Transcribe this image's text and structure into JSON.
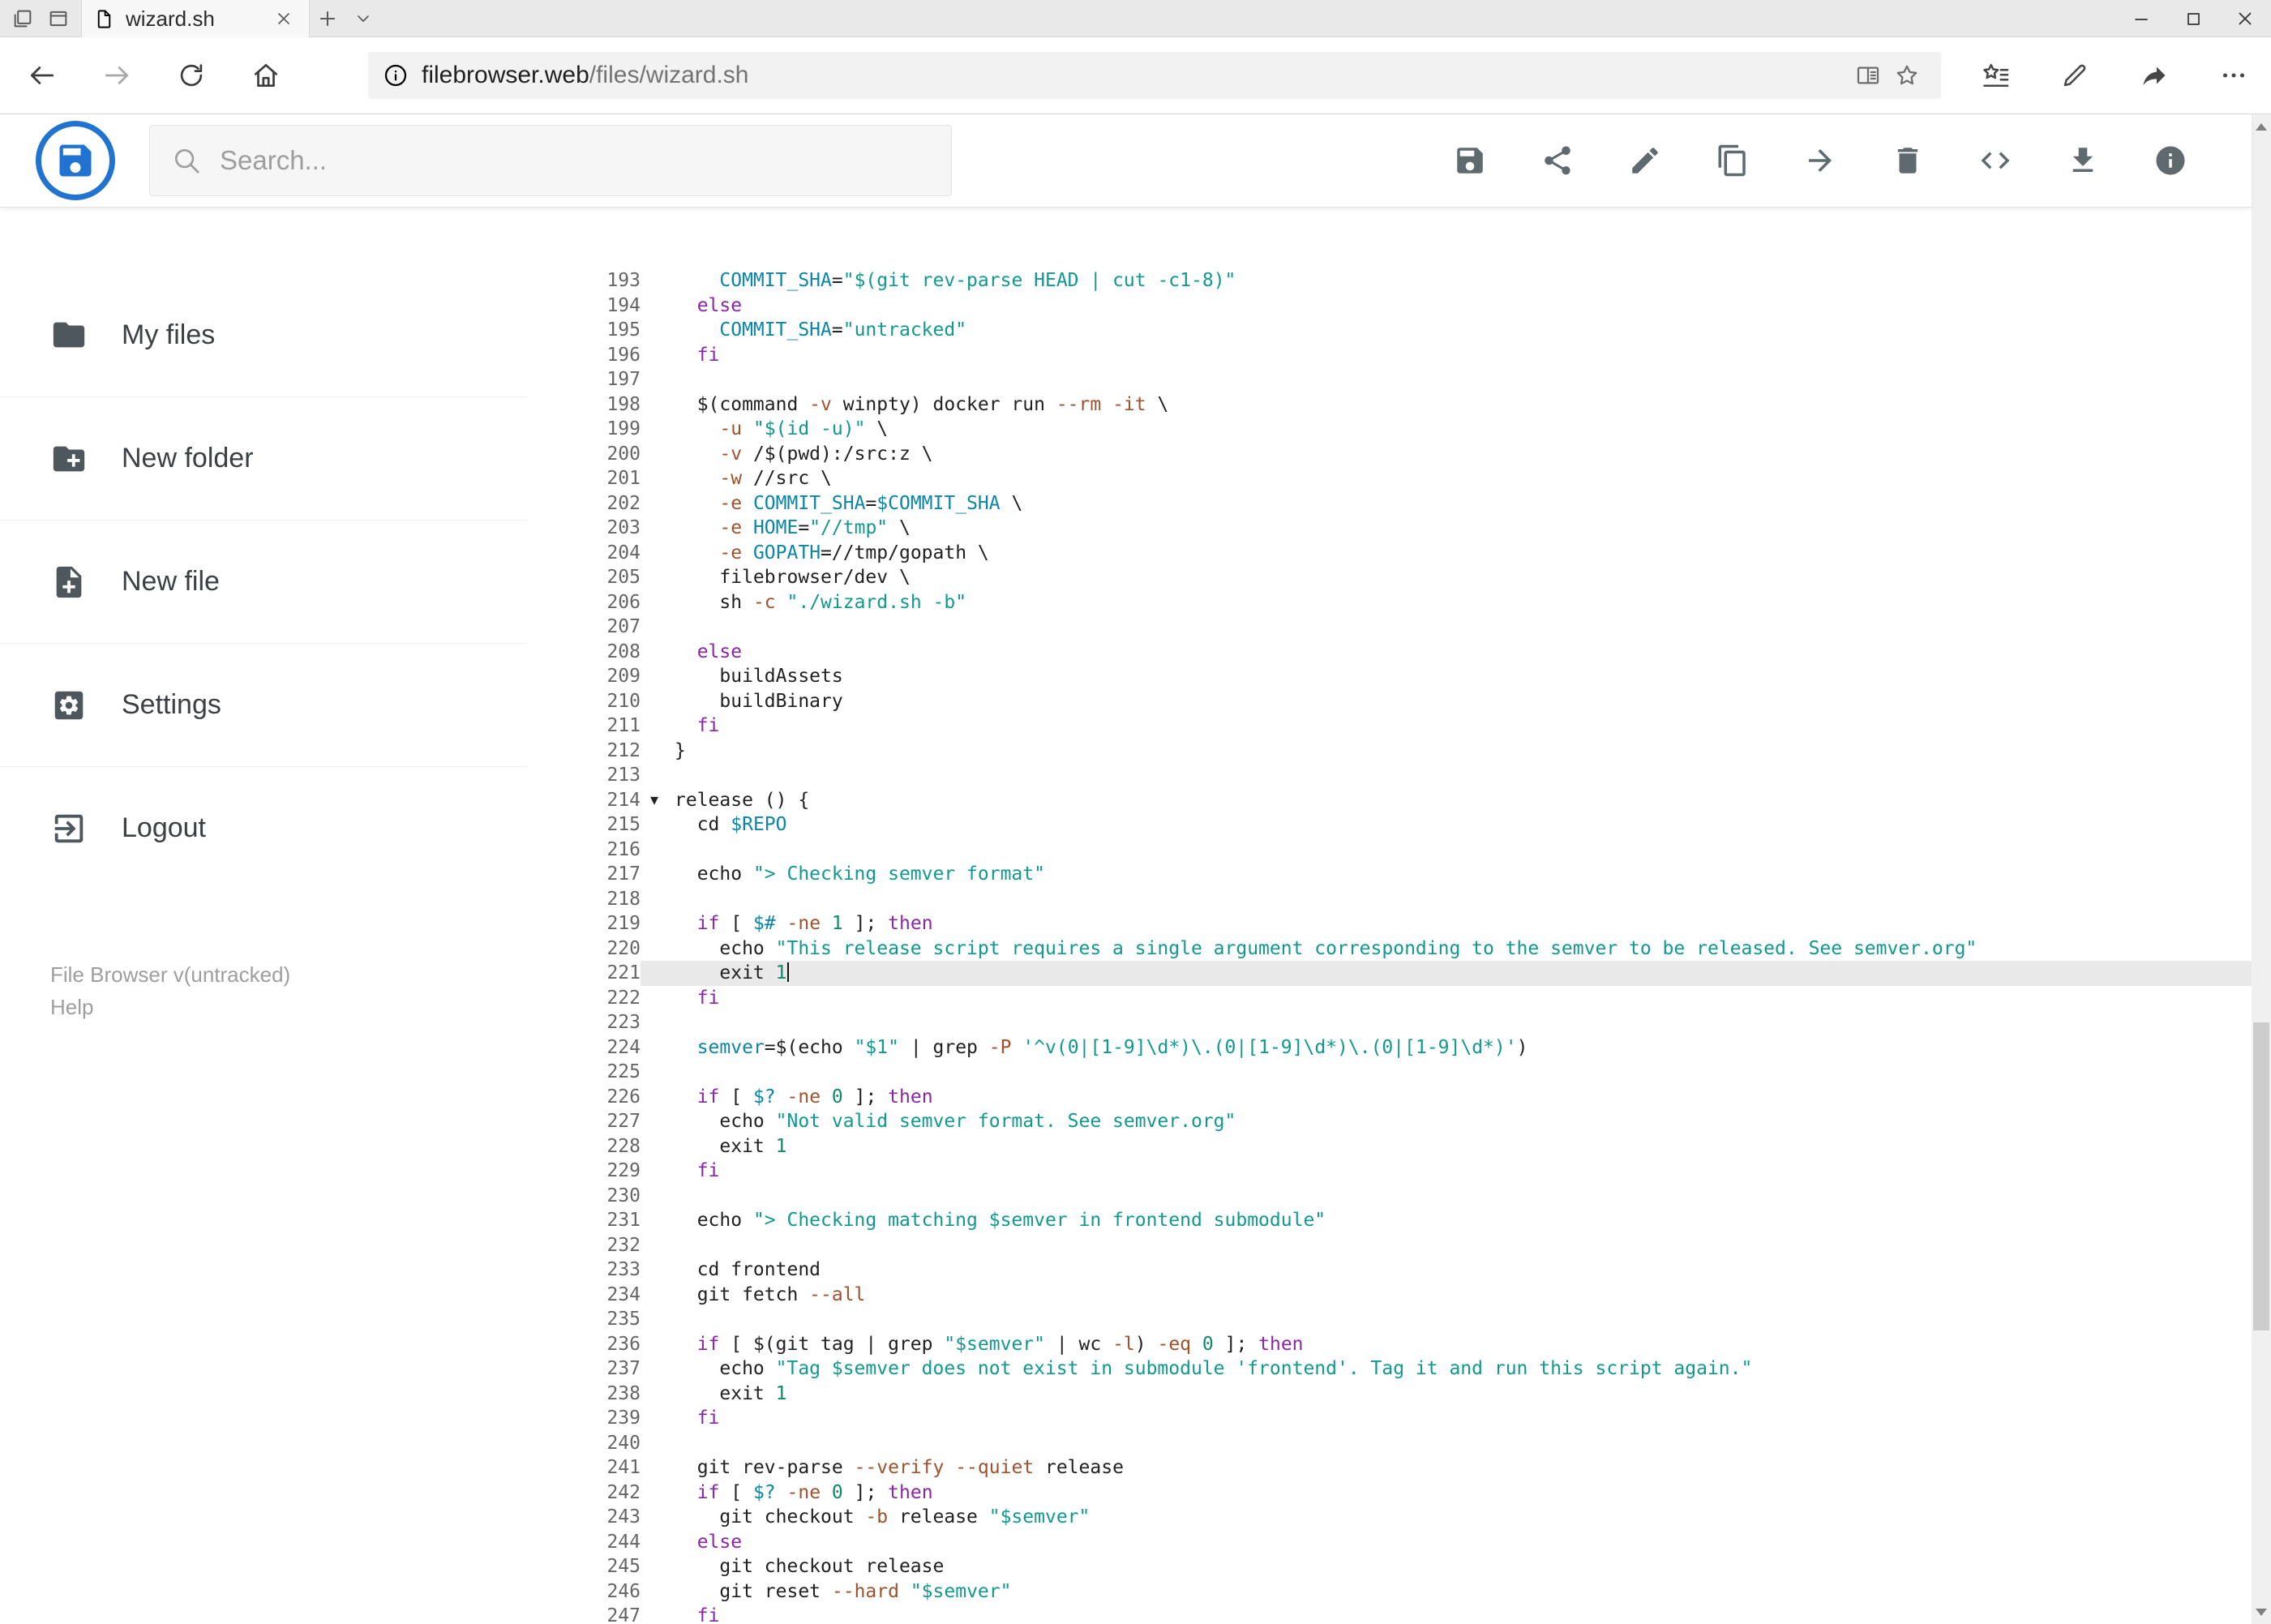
{
  "browser": {
    "tab_title": "wizard.sh",
    "url_domain": "filebrowser.web",
    "url_path": "/files/wizard.sh",
    "nav_icons": [
      "back-icon",
      "forward-icon",
      "refresh-icon",
      "home-icon"
    ],
    "address_icons": [
      "info-icon",
      "reading-view-icon",
      "favorite-star-icon"
    ],
    "hub_icons": [
      "favorites-hub-icon",
      "web-note-icon",
      "share-page-icon",
      "more-options-icon"
    ],
    "window_icons": [
      "minimize-icon",
      "maximize-icon",
      "close-icon"
    ]
  },
  "header": {
    "search_placeholder": "Search...",
    "actions": [
      {
        "id": "save",
        "icon": "save-icon"
      },
      {
        "id": "share",
        "icon": "share-icon"
      },
      {
        "id": "edit",
        "icon": "edit-icon"
      },
      {
        "id": "copy",
        "icon": "copy-icon"
      },
      {
        "id": "move",
        "icon": "move-icon"
      },
      {
        "id": "delete",
        "icon": "delete-icon"
      },
      {
        "id": "code",
        "icon": "code-icon"
      },
      {
        "id": "download",
        "icon": "download-icon"
      },
      {
        "id": "info",
        "icon": "info-icon"
      }
    ]
  },
  "sidebar": {
    "items": [
      {
        "id": "my-files",
        "label": "My files",
        "icon": "folder-icon"
      },
      {
        "id": "new-folder",
        "label": "New folder",
        "icon": "create-new-folder-icon"
      },
      {
        "id": "new-file",
        "label": "New file",
        "icon": "note-add-icon"
      },
      {
        "id": "settings",
        "label": "Settings",
        "icon": "settings-icon"
      },
      {
        "id": "logout",
        "label": "Logout",
        "icon": "logout-icon"
      }
    ],
    "footer": {
      "version": "File Browser v(untracked)",
      "help": "Help"
    }
  },
  "editor": {
    "active_line": 221,
    "lines": [
      {
        "n": 193,
        "t": "    COMMIT_SHA=\"$(git rev-parse HEAD | cut -c1-8)\""
      },
      {
        "n": 194,
        "t": "  else"
      },
      {
        "n": 195,
        "t": "    COMMIT_SHA=\"untracked\""
      },
      {
        "n": 196,
        "t": "  fi"
      },
      {
        "n": 197,
        "t": ""
      },
      {
        "n": 198,
        "t": "  $(command -v winpty) docker run --rm -it \\"
      },
      {
        "n": 199,
        "t": "    -u \"$(id -u)\" \\"
      },
      {
        "n": 200,
        "t": "    -v /$(pwd):/src:z \\"
      },
      {
        "n": 201,
        "t": "    -w //src \\"
      },
      {
        "n": 202,
        "t": "    -e COMMIT_SHA=$COMMIT_SHA \\"
      },
      {
        "n": 203,
        "t": "    -e HOME=\"//tmp\" \\"
      },
      {
        "n": 204,
        "t": "    -e GOPATH=//tmp/gopath \\"
      },
      {
        "n": 205,
        "t": "    filebrowser/dev \\"
      },
      {
        "n": 206,
        "t": "    sh -c \"./wizard.sh -b\""
      },
      {
        "n": 207,
        "t": ""
      },
      {
        "n": 208,
        "t": "  else"
      },
      {
        "n": 209,
        "t": "    buildAssets"
      },
      {
        "n": 210,
        "t": "    buildBinary"
      },
      {
        "n": 211,
        "t": "  fi"
      },
      {
        "n": 212,
        "t": "}"
      },
      {
        "n": 213,
        "t": ""
      },
      {
        "n": 214,
        "t": "release () {",
        "fold": true
      },
      {
        "n": 215,
        "t": "  cd $REPO"
      },
      {
        "n": 216,
        "t": ""
      },
      {
        "n": 217,
        "t": "  echo \"> Checking semver format\""
      },
      {
        "n": 218,
        "t": ""
      },
      {
        "n": 219,
        "t": "  if [ $# -ne 1 ]; then"
      },
      {
        "n": 220,
        "t": "    echo \"This release script requires a single argument corresponding to the semver to be released. See semver.org\""
      },
      {
        "n": 221,
        "t": "    exit 1"
      },
      {
        "n": 222,
        "t": "  fi"
      },
      {
        "n": 223,
        "t": ""
      },
      {
        "n": 224,
        "t": "  semver=$(echo \"$1\" | grep -P '^v(0|[1-9]\\d*)\\.(0|[1-9]\\d*)\\.(0|[1-9]\\d*)')"
      },
      {
        "n": 225,
        "t": ""
      },
      {
        "n": 226,
        "t": "  if [ $? -ne 0 ]; then"
      },
      {
        "n": 227,
        "t": "    echo \"Not valid semver format. See semver.org\""
      },
      {
        "n": 228,
        "t": "    exit 1"
      },
      {
        "n": 229,
        "t": "  fi"
      },
      {
        "n": 230,
        "t": ""
      },
      {
        "n": 231,
        "t": "  echo \"> Checking matching $semver in frontend submodule\""
      },
      {
        "n": 232,
        "t": ""
      },
      {
        "n": 233,
        "t": "  cd frontend"
      },
      {
        "n": 234,
        "t": "  git fetch --all"
      },
      {
        "n": 235,
        "t": ""
      },
      {
        "n": 236,
        "t": "  if [ $(git tag | grep \"$semver\" | wc -l) -eq 0 ]; then"
      },
      {
        "n": 237,
        "t": "    echo \"Tag $semver does not exist in submodule 'frontend'. Tag it and run this script again.\""
      },
      {
        "n": 238,
        "t": "    exit 1"
      },
      {
        "n": 239,
        "t": "  fi"
      },
      {
        "n": 240,
        "t": ""
      },
      {
        "n": 241,
        "t": "  git rev-parse --verify --quiet release"
      },
      {
        "n": 242,
        "t": "  if [ $? -ne 0 ]; then"
      },
      {
        "n": 243,
        "t": "    git checkout -b release \"$semver\""
      },
      {
        "n": 244,
        "t": "  else"
      },
      {
        "n": 245,
        "t": "    git checkout release"
      },
      {
        "n": 246,
        "t": "    git reset --hard \"$semver\""
      },
      {
        "n": 247,
        "t": "  fi"
      }
    ]
  },
  "colors": {
    "accent_blue": "#2173d2",
    "keyword": "#8b26a8",
    "string": "#12998f",
    "variable": "#0c86a8",
    "flag": "#a0522d",
    "number": "#108a6a",
    "active_line_bg": "#e9e9e9"
  }
}
